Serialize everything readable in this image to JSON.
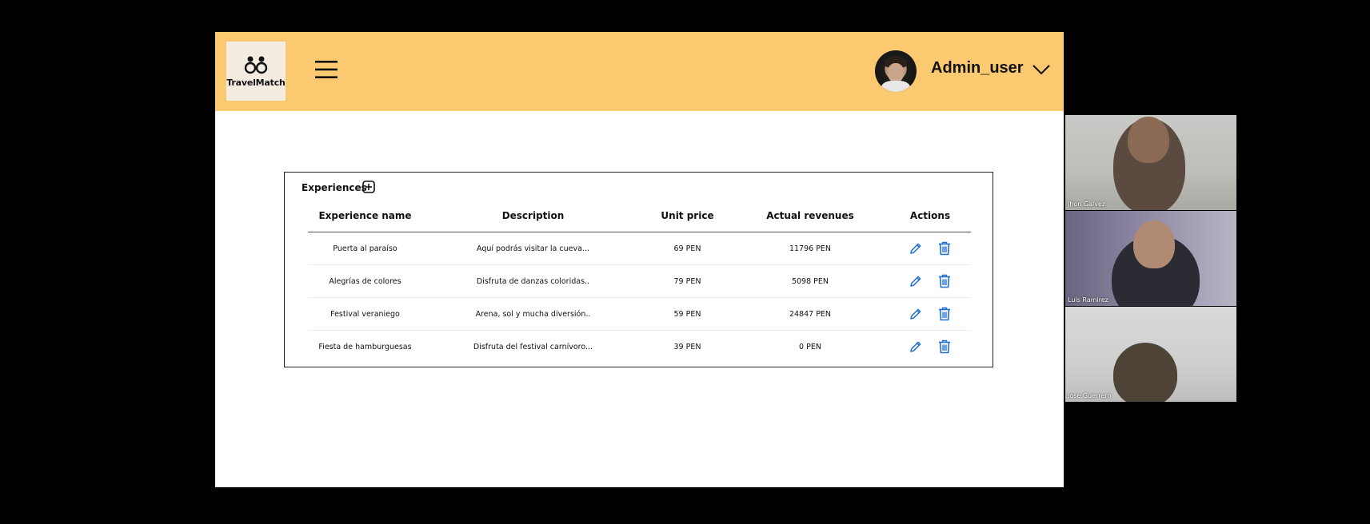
{
  "app": {
    "logo_text": "TravelMatch",
    "username": "Admin_user"
  },
  "experiences": {
    "title": "Experiences",
    "columns": [
      "Experience name",
      "Description",
      "Unit price",
      "Actual revenues",
      "Actions"
    ],
    "rows": [
      {
        "name": "Puerta al paraíso",
        "description": "Aquí podrás visitar la cueva...",
        "price": "69 PEN",
        "revenue": "11796 PEN"
      },
      {
        "name": "Alegrías de colores",
        "description": "Disfruta de danzas coloridas..",
        "price": "79 PEN",
        "revenue": "5098 PEN"
      },
      {
        "name": "Festival veraniego",
        "description": "Arena, sol y mucha diversión..",
        "price": "59 PEN",
        "revenue": "24847 PEN"
      },
      {
        "name": "Fiesta de hamburguesas",
        "description": "Disfruta del festival carnívoro...",
        "price": "39 PEN",
        "revenue": "0 PEN"
      }
    ]
  },
  "participants": [
    {
      "name": "Jhon Galvez"
    },
    {
      "name": "Luis Ramirez"
    },
    {
      "name": "Jose Guerrero"
    }
  ],
  "colors": {
    "header_bg": "#fbc96f",
    "action_blue": "#1f6fd1"
  },
  "icons": [
    "link-logo-icon",
    "hamburger-menu-icon",
    "chevron-down-icon",
    "add-icon",
    "edit-icon",
    "trash-icon"
  ]
}
